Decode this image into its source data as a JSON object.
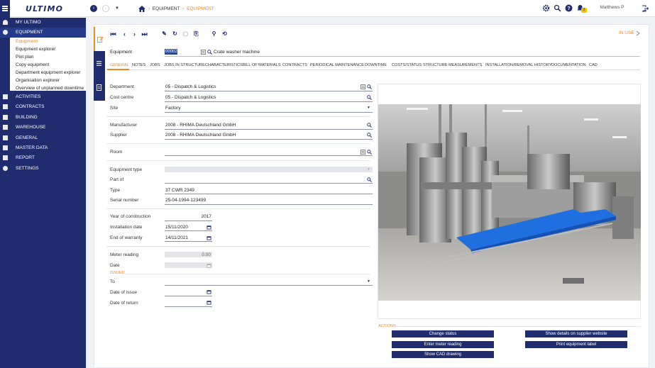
{
  "app": {
    "name": "ULTIMO"
  },
  "breadcrumb": {
    "items": [
      "EQUIPMENT",
      "EQUIPMENT"
    ]
  },
  "user": {
    "name": "Matthews P"
  },
  "notification_badge": "2",
  "sidebar": {
    "top_items": [
      "MY ULTIMO",
      "EQUIPMENT"
    ],
    "sub_items": [
      "Equipment",
      "Equipment explorer",
      "Plot plan",
      "Copy equipment",
      "Department equipment explorer",
      "Organisation explorer",
      "Overview of unplanned downtime"
    ],
    "lower_items": [
      "ACTIVITIES",
      "CONTRACTS",
      "BUILDING",
      "WAREHOUSE",
      "GENERAL",
      "MASTER DATA",
      "REPORT",
      "SETTINGS"
    ]
  },
  "status": "IN USE",
  "equipment": {
    "label": "Equipment",
    "id": "00002",
    "name": "Crate washer machine"
  },
  "tabs": [
    "GENERAL",
    "NOTES",
    "JOBS",
    "JOBS IN STRUCTURE",
    "CHARACTERISTICS",
    "BILL OF MATERIALS",
    "CONTRACTS",
    "PERIODICAL MAINTENANCE",
    "DOWNTIME",
    "COSTS/STATUS",
    "STRUCTURE",
    "MEASUREMENTS",
    "INSTALLATION/REMOVAL HISTORY",
    "DOCUMENTATION",
    "CAD"
  ],
  "active_tab": "GENERAL",
  "fields": {
    "department": {
      "label": "Department",
      "value": "05 - Dispatch & Logistics"
    },
    "cost_centre": {
      "label": "Cost centre",
      "value": "05 - Dispatch & Logistics"
    },
    "site": {
      "label": "Site",
      "value": "Factory"
    },
    "manufacturer": {
      "label": "Manufacturer",
      "value": "2008 - RHIMA Deutschland GmbH"
    },
    "supplier": {
      "label": "Supplier",
      "value": "2008 - RHIMA Deutschland GmbH"
    },
    "room": {
      "label": "Room",
      "value": ""
    },
    "equipment_type": {
      "label": "Equipment type",
      "value": ""
    },
    "part_of": {
      "label": "Part of",
      "value": ""
    },
    "type": {
      "label": "Type",
      "value": "37 CWR 2349"
    },
    "serial_number": {
      "label": "Serial number",
      "value": "25-04-1994-123499"
    },
    "year_of_construction": {
      "label": "Year of construction",
      "value": "2017"
    },
    "installation_date": {
      "label": "Installation date",
      "value": "15/11/2020"
    },
    "end_of_warranty": {
      "label": "End of warranty",
      "value": "14/11/2021"
    },
    "meter_reading": {
      "label": "Meter reading",
      "value": "0.00"
    },
    "date": {
      "label": "Date",
      "value": ""
    },
    "issued_section": "ISSUED",
    "to": {
      "label": "To",
      "value": ""
    },
    "date_of_issue": {
      "label": "Date of issue",
      "value": ""
    },
    "date_of_return": {
      "label": "Date of return",
      "value": ""
    }
  },
  "actions": {
    "title": "ACTIONS",
    "buttons": [
      "Change status",
      "Show details on supplier website",
      "Enter meter reading",
      "Print equipment label",
      "Show CAD drawing"
    ]
  },
  "colors": {
    "navy": "#1f2d6e",
    "accent": "#f08a1c",
    "conveyor": "#1f6fe0"
  }
}
